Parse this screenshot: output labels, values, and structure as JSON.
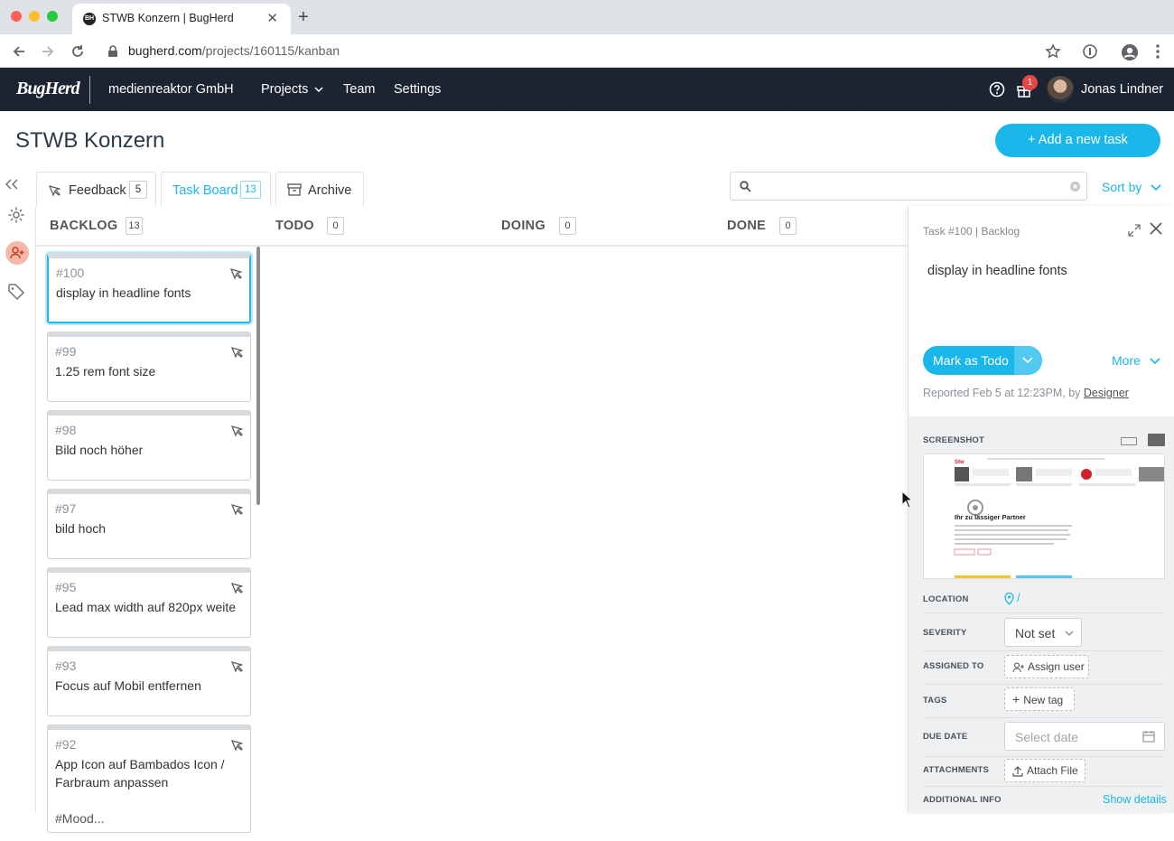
{
  "browser": {
    "tab_title": "STWB Konzern | BugHerd",
    "tab_favicon": "BH",
    "url_host": "bugherd.com",
    "url_path": "/projects/160115/kanban"
  },
  "header": {
    "logo": "BugHerd",
    "org": "medienreaktor GmbH",
    "nav": {
      "projects": "Projects",
      "team": "Team",
      "settings": "Settings"
    },
    "gift_badge": "1",
    "user_name": "Jonas Lindner"
  },
  "page": {
    "project_title": "STWB Konzern",
    "add_task": "+ Add a new task",
    "tabs": {
      "feedback": {
        "label": "Feedback",
        "count": "5"
      },
      "taskboard": {
        "label": "Task Board",
        "count": "13"
      },
      "archive": {
        "label": "Archive"
      }
    },
    "sort_by": "Sort by"
  },
  "columns": {
    "backlog": {
      "label": "BACKLOG",
      "count": "13"
    },
    "todo": {
      "label": "TODO",
      "count": "0"
    },
    "doing": {
      "label": "DOING",
      "count": "0"
    },
    "done": {
      "label": "DONE",
      "count": "0"
    }
  },
  "cards": [
    {
      "num": "#100",
      "title": "display in headline fonts"
    },
    {
      "num": "#99",
      "title": "1.25 rem font size"
    },
    {
      "num": "#98",
      "title": "Bild noch höher"
    },
    {
      "num": "#97",
      "title": "bild hoch"
    },
    {
      "num": "#95",
      "title": "Lead max width auf 820px weite"
    },
    {
      "num": "#93",
      "title": "Focus auf Mobil entfernen"
    },
    {
      "num": "#92",
      "title": "App Icon auf Bambados Icon / Farbraum anpassen",
      "extra": "#Mood..."
    }
  ],
  "panel": {
    "task_ref": "Task #100 | Backlog",
    "description": "display in headline fonts",
    "mark_button": "Mark as Todo",
    "more": "More",
    "reported_prefix": "Reported Feb 5 at 12:23PM, by",
    "reported_by": "Designer",
    "labels": {
      "screenshot": "SCREENSHOT",
      "location": "LOCATION",
      "severity": "SEVERITY",
      "assigned_to": "ASSIGNED TO",
      "tags": "TAGS",
      "due_date": "DUE DATE",
      "attachments": "ATTACHMENTS",
      "additional_info": "ADDITIONAL INFO"
    },
    "location_value": "/",
    "severity_value": "Not set",
    "assign_user": "Assign user",
    "new_tag": "New tag",
    "due_placeholder": "Select date",
    "attach_file": "Attach File",
    "show_details": "Show details",
    "screenshot_preview": {
      "heading": "Ihr zu   lässiger Partner"
    }
  },
  "colors": {
    "accent": "#1ab7ea",
    "header_bg": "#1b2430",
    "badge": "#e84747"
  }
}
